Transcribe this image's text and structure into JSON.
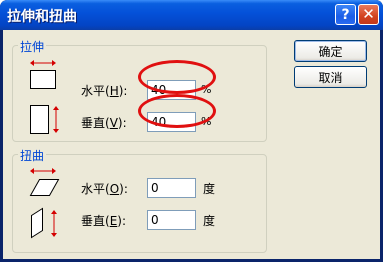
{
  "window": {
    "title": "拉伸和扭曲",
    "help_glyph": "?",
    "close_glyph": "✕"
  },
  "stretch": {
    "group_label": "拉伸",
    "horizontal": {
      "label_prefix": "水平(",
      "mnemonic": "H",
      "label_suffix": "):",
      "value": "40",
      "unit": "%"
    },
    "vertical": {
      "label_prefix": "垂直(",
      "mnemonic": "V",
      "label_suffix": "):",
      "value": "40",
      "unit": "%"
    }
  },
  "skew": {
    "group_label": "扭曲",
    "horizontal": {
      "label_prefix": "水平(",
      "mnemonic": "O",
      "label_suffix": "):",
      "value": "0",
      "unit": "度"
    },
    "vertical": {
      "label_prefix": "垂直(",
      "mnemonic": "E",
      "label_suffix": "):",
      "value": "0",
      "unit": "度"
    }
  },
  "buttons": {
    "ok": "确定",
    "cancel": "取消"
  },
  "colors": {
    "highlight": "#e01010",
    "arrow": "#d40000",
    "group_label": "#0046d5"
  }
}
